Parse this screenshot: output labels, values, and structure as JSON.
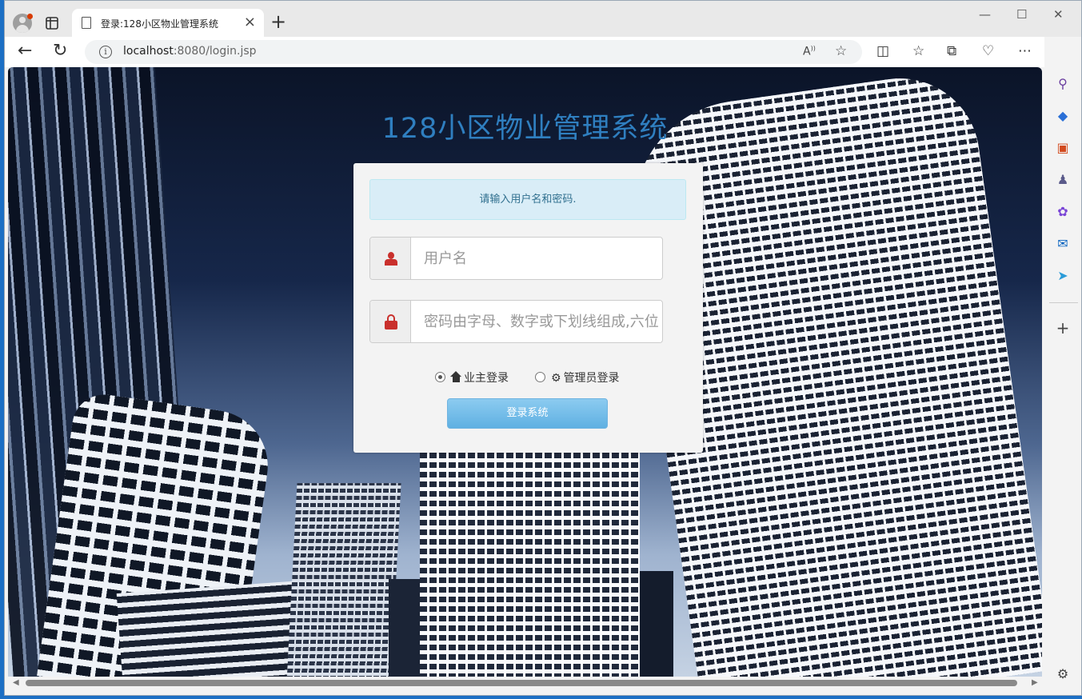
{
  "browser": {
    "tab_title": "登录:128小区物业管理系统",
    "url_host": "localhost",
    "url_rest": ":8080/login.jsp"
  },
  "page": {
    "title": "128小区物业管理系统",
    "alert": "请输入用户名和密码.",
    "username_placeholder": "用户名",
    "password_placeholder": "密码由字母、数字或下划线组成,六位",
    "radio_owner": "业主登录",
    "radio_admin": "管理员登录",
    "selected_role": "业主登录",
    "submit": "登录系统"
  },
  "colors": {
    "title": "#2f7fc0",
    "icon_red": "#c9302c",
    "alert_bg": "#d9edf7",
    "button": "#5fb0e2"
  },
  "icons": [
    "user-icon",
    "lock-icon",
    "home-icon",
    "cog-icon"
  ]
}
